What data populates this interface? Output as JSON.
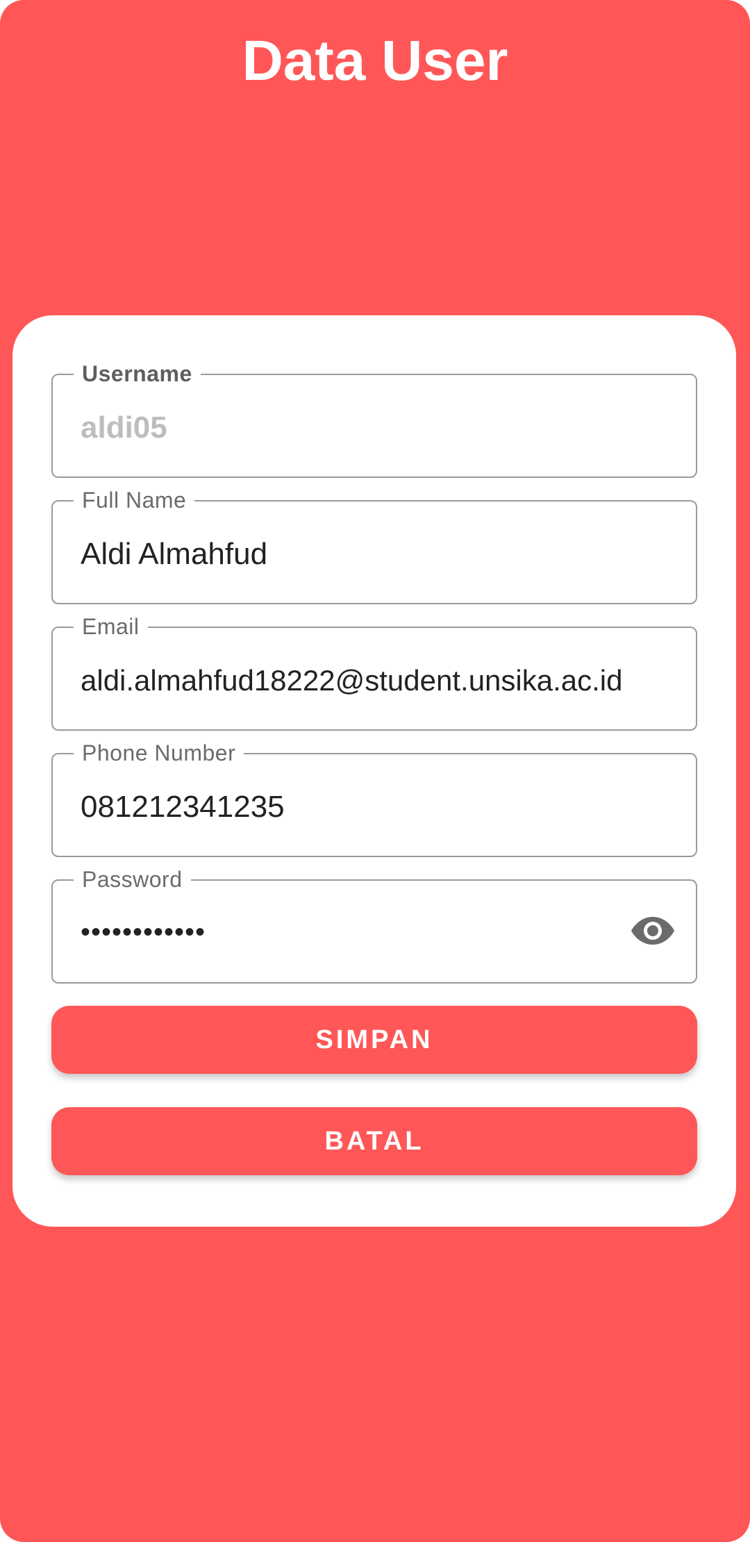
{
  "page": {
    "title": "Data User"
  },
  "form": {
    "username": {
      "label": "Username",
      "value": "aldi05"
    },
    "full_name": {
      "label": "Full Name",
      "value": "Aldi Almahfud"
    },
    "email": {
      "label": "Email",
      "value": "aldi.almahfud18222@student.unsika.ac.id"
    },
    "phone": {
      "label": "Phone Number",
      "value": "081212341235"
    },
    "password": {
      "label": "Password",
      "value": "••••••••••••",
      "toggle_icon": "eye-icon"
    }
  },
  "actions": {
    "save_label": "SIMPAN",
    "cancel_label": "BATAL"
  },
  "colors": {
    "primary": "#FF5757",
    "card": "#FFFFFF",
    "outline": "#9A9A9A",
    "label": "#6B6B6B",
    "text": "#222222",
    "disabled_text": "#BDBDBD"
  }
}
